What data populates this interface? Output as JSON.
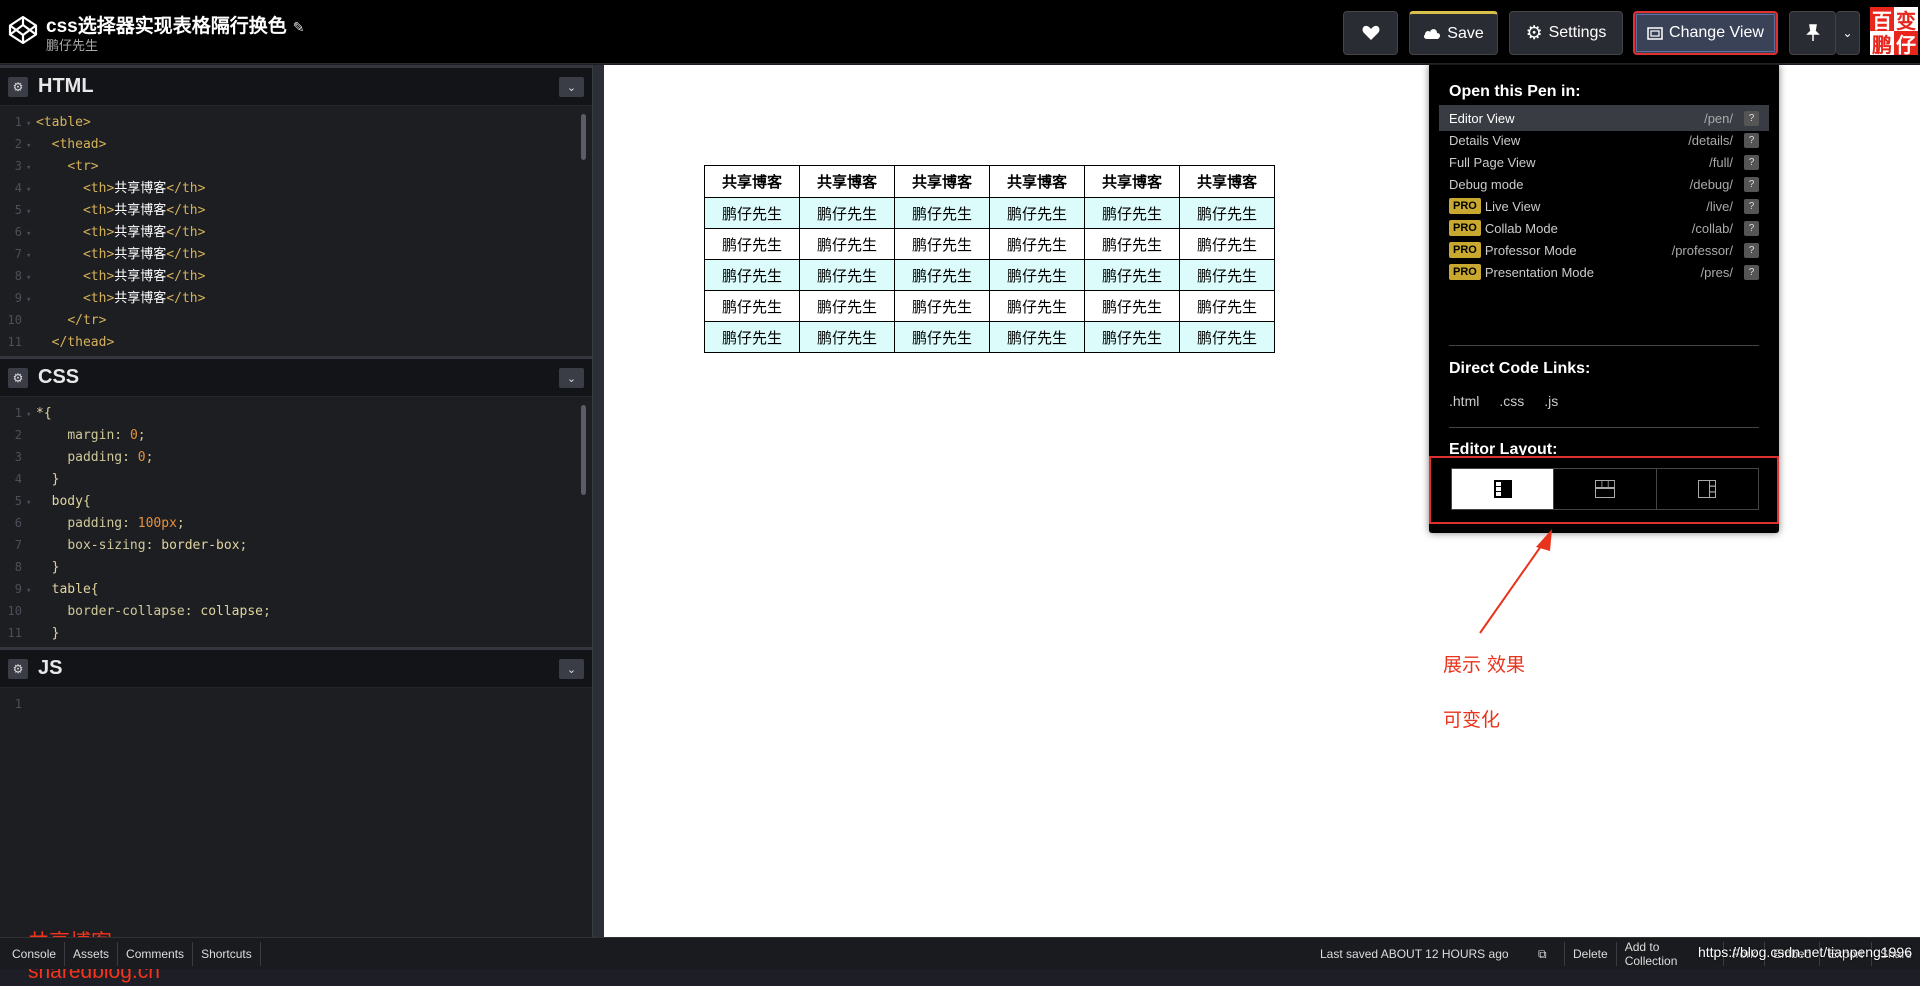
{
  "header": {
    "title": "css选择器实现表格隔行换色",
    "author": "鹏仔先生",
    "save_label": "Save",
    "settings_label": "Settings",
    "change_view_label": "Change View",
    "brand_chars": [
      "百",
      "变",
      "鹏",
      "仔"
    ]
  },
  "html_panel": {
    "title": "HTML",
    "lines": [
      {
        "n": "1",
        "fold": "▾",
        "indent": "",
        "open": "<table>",
        "text": "",
        "close": ""
      },
      {
        "n": "2",
        "fold": "▾",
        "indent": "  ",
        "open": "<thead>",
        "text": "",
        "close": ""
      },
      {
        "n": "3",
        "fold": "▾",
        "indent": "    ",
        "open": "<tr>",
        "text": "",
        "close": ""
      },
      {
        "n": "4",
        "fold": "▾",
        "indent": "      ",
        "open": "<th>",
        "text": "共享博客",
        "close": "</th>"
      },
      {
        "n": "5",
        "fold": "▾",
        "indent": "      ",
        "open": "<th>",
        "text": "共享博客",
        "close": "</th>"
      },
      {
        "n": "6",
        "fold": "▾",
        "indent": "      ",
        "open": "<th>",
        "text": "共享博客",
        "close": "</th>"
      },
      {
        "n": "7",
        "fold": "▾",
        "indent": "      ",
        "open": "<th>",
        "text": "共享博客",
        "close": "</th>"
      },
      {
        "n": "8",
        "fold": "▾",
        "indent": "      ",
        "open": "<th>",
        "text": "共享博客",
        "close": "</th>"
      },
      {
        "n": "9",
        "fold": "▾",
        "indent": "      ",
        "open": "<th>",
        "text": "共享博客",
        "close": "</th>"
      },
      {
        "n": "10",
        "fold": "",
        "indent": "    ",
        "open": "</tr>",
        "text": "",
        "close": ""
      },
      {
        "n": "11",
        "fold": "",
        "indent": "  ",
        "open": "</thead>",
        "text": "",
        "close": ""
      }
    ]
  },
  "css_panel": {
    "title": "CSS",
    "lines": [
      {
        "n": "1",
        "fold": "▾",
        "indent": "",
        "sel": "*{",
        "prop": "",
        "val": "",
        "end": ""
      },
      {
        "n": "2",
        "fold": "",
        "indent": "    ",
        "sel": "",
        "prop": "margin",
        "val": "0",
        "end": ";"
      },
      {
        "n": "3",
        "fold": "",
        "indent": "    ",
        "sel": "",
        "prop": "padding",
        "val": "0",
        "end": ";"
      },
      {
        "n": "4",
        "fold": "",
        "indent": "  ",
        "sel": "}",
        "prop": "",
        "val": "",
        "end": ""
      },
      {
        "n": "5",
        "fold": "▾",
        "indent": "  ",
        "sel": "body{",
        "prop": "",
        "val": "",
        "end": ""
      },
      {
        "n": "6",
        "fold": "",
        "indent": "    ",
        "sel": "",
        "prop": "padding",
        "val": "100px",
        "end": ";"
      },
      {
        "n": "7",
        "fold": "",
        "indent": "    ",
        "sel": "",
        "prop": "box-sizing",
        "val": "border-box",
        "end": ";"
      },
      {
        "n": "8",
        "fold": "",
        "indent": "  ",
        "sel": "}",
        "prop": "",
        "val": "",
        "end": ""
      },
      {
        "n": "9",
        "fold": "▾",
        "indent": "  ",
        "sel": "table{",
        "prop": "",
        "val": "",
        "end": ""
      },
      {
        "n": "10",
        "fold": "",
        "indent": "    ",
        "sel": "",
        "prop": "border-collapse",
        "val": "collapse",
        "end": ";"
      },
      {
        "n": "11",
        "fold": "",
        "indent": "  ",
        "sel": "}",
        "prop": "",
        "val": "",
        "end": ""
      }
    ]
  },
  "js_panel": {
    "title": "JS",
    "lines": [
      {
        "n": "1"
      }
    ]
  },
  "watermark": {
    "line1": "共享博客",
    "line2": "sharedblog.cn"
  },
  "preview_table": {
    "headers": [
      "共享博客",
      "共享博客",
      "共享博客",
      "共享博客",
      "共享博客",
      "共享博客"
    ],
    "rows": [
      [
        "鹏仔先生",
        "鹏仔先生",
        "鹏仔先生",
        "鹏仔先生",
        "鹏仔先生",
        "鹏仔先生"
      ],
      [
        "鹏仔先生",
        "鹏仔先生",
        "鹏仔先生",
        "鹏仔先生",
        "鹏仔先生",
        "鹏仔先生"
      ],
      [
        "鹏仔先生",
        "鹏仔先生",
        "鹏仔先生",
        "鹏仔先生",
        "鹏仔先生",
        "鹏仔先生"
      ],
      [
        "鹏仔先生",
        "鹏仔先生",
        "鹏仔先生",
        "鹏仔先生",
        "鹏仔先生",
        "鹏仔先生"
      ],
      [
        "鹏仔先生",
        "鹏仔先生",
        "鹏仔先生",
        "鹏仔先生",
        "鹏仔先生",
        "鹏仔先生"
      ]
    ]
  },
  "dropdown": {
    "open_heading": "Open this Pen in:",
    "items": [
      {
        "label": "Editor View",
        "path": "/pen/",
        "pro": false,
        "active": true
      },
      {
        "label": "Details View",
        "path": "/details/",
        "pro": false,
        "active": false
      },
      {
        "label": "Full Page View",
        "path": "/full/",
        "pro": false,
        "active": false
      },
      {
        "label": "Debug mode",
        "path": "/debug/",
        "pro": false,
        "active": false
      },
      {
        "label": "Live View",
        "path": "/live/",
        "pro": true,
        "active": false
      },
      {
        "label": "Collab Mode",
        "path": "/collab/",
        "pro": true,
        "active": false
      },
      {
        "label": "Professor Mode",
        "path": "/professor/",
        "pro": true,
        "active": false
      },
      {
        "label": "Presentation Mode",
        "path": "/pres/",
        "pro": true,
        "active": false
      }
    ],
    "pro_label": "PRO",
    "help_label": "?",
    "direct_heading": "Direct Code Links:",
    "code_links": [
      ".html",
      ".css",
      ".js"
    ],
    "layout_heading": "Editor Layout:"
  },
  "annotations": {
    "line1": "展示 效果",
    "line2": "可变化"
  },
  "footer": {
    "left_buttons": [
      "Console",
      "Assets",
      "Comments",
      "Shortcuts"
    ],
    "last_saved": "Last saved ABOUT 12 HOURS ago",
    "right_buttons": [
      "Delete",
      "Add to Collection",
      "Fork",
      "Embed",
      "Export",
      "Share"
    ],
    "csdn": "https://blog.csdn.net/tianpeng1996"
  },
  "colors": {
    "accent_red": "#e03131",
    "row_highlight": "#dcfcfc",
    "pro_badge": "#c8a82e",
    "save_border": "#d8c04b"
  }
}
